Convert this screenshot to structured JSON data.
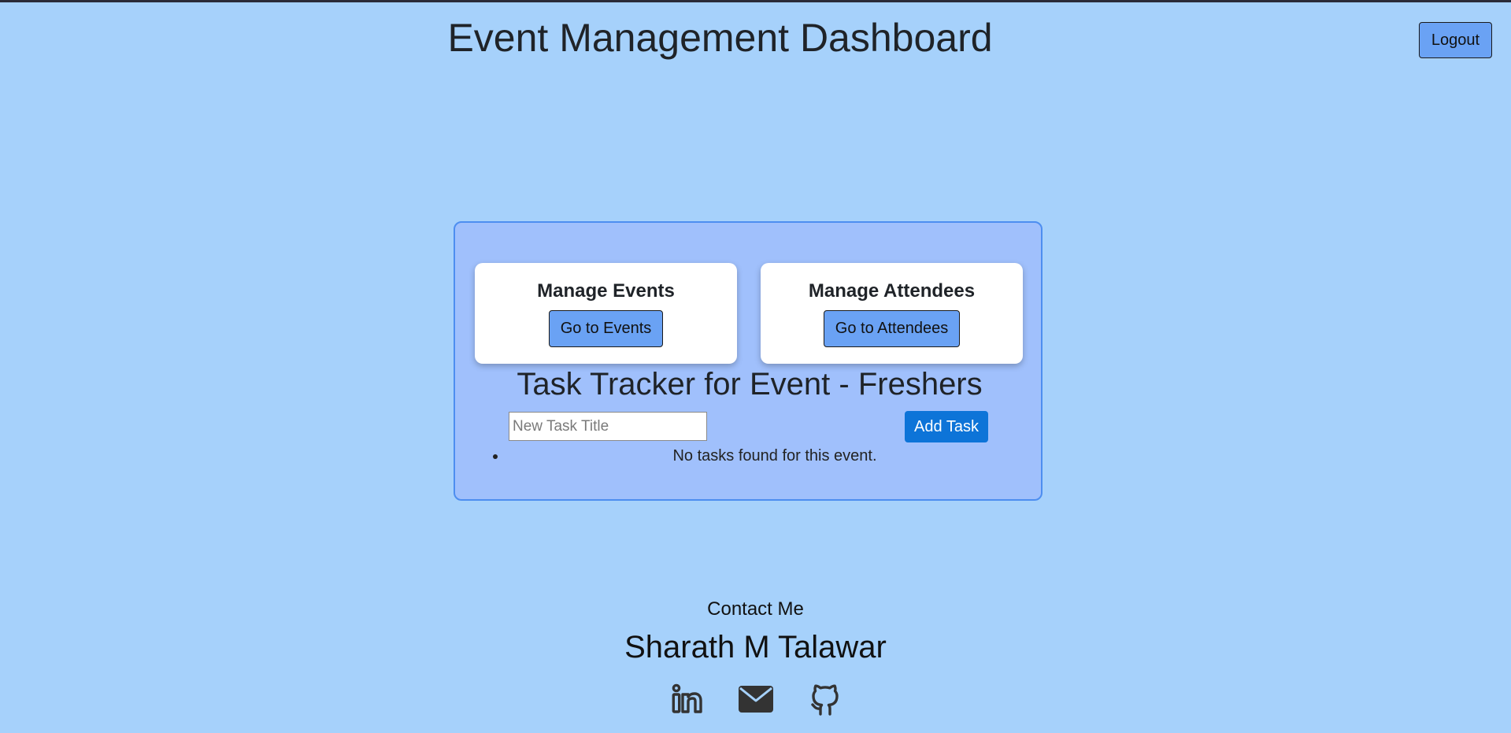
{
  "header": {
    "title": "Event Management Dashboard",
    "logout_label": "Logout"
  },
  "cards": [
    {
      "title": "Manage Events",
      "button_label": "Go to Events"
    },
    {
      "title": "Manage Attendees",
      "button_label": "Go to Attendees"
    }
  ],
  "task_tracker": {
    "title": "Task Tracker for Event - Freshers",
    "input_placeholder": "New Task Title",
    "input_value": "",
    "add_button_label": "Add Task",
    "empty_message": "No tasks found for this event."
  },
  "footer": {
    "contact_heading": "Contact Me",
    "name": "Sharath M Talawar",
    "social_icons": [
      "linkedin-icon",
      "email-icon",
      "github-icon"
    ]
  },
  "colors": {
    "page_background": "#a6d1fb",
    "panel_background": "#a0c0fc",
    "panel_border": "#4d8ef0",
    "secondary_button": "#6aa2f4",
    "primary_button": "#0d74d8",
    "icon_color": "#333333"
  }
}
